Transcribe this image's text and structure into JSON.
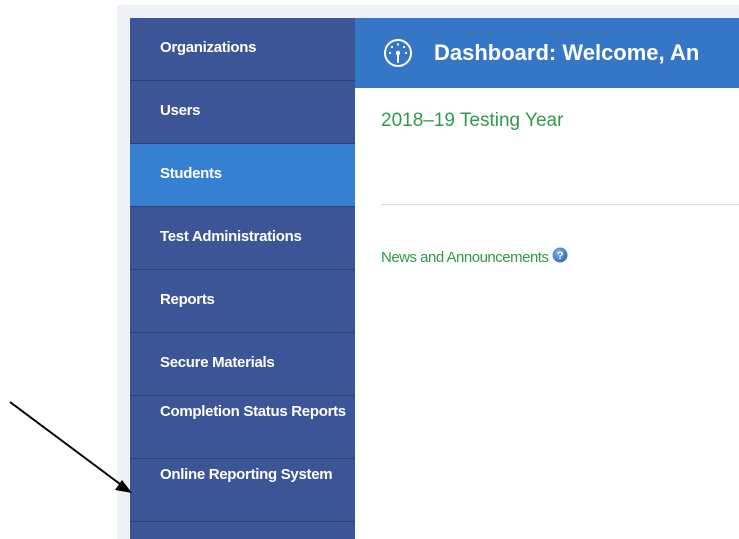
{
  "sidebar": {
    "items": [
      {
        "label": "Organizations"
      },
      {
        "label": "Users"
      },
      {
        "label": "Students"
      },
      {
        "label": "Test Administrations"
      },
      {
        "label": "Reports"
      },
      {
        "label": "Secure Materials"
      },
      {
        "label": "Completion Status Reports"
      },
      {
        "label": "Online Reporting System"
      }
    ],
    "active_item": "Students"
  },
  "header": {
    "title": "Dashboard: Welcome, An",
    "icon": "dashboard-gauge-icon"
  },
  "main": {
    "testing_year": "2018–19 Testing Year",
    "news_label": "News and Announcements",
    "news_help_icon": "help-icon"
  },
  "colors": {
    "sidebar": "#3b5597",
    "sidebar_active": "#3680d1",
    "header": "#3576c6",
    "green_text": "#2f9a4a"
  },
  "annotation": {
    "icon": "arrow-icon",
    "points_to": "Online Reporting System"
  }
}
